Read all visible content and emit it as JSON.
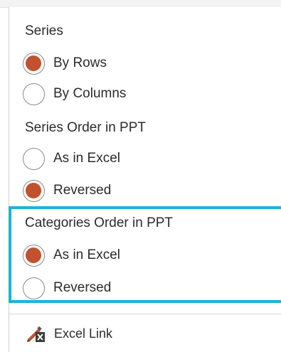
{
  "menu": {
    "series_heading": "Series",
    "series_options": [
      {
        "label": "By Rows",
        "selected": true
      },
      {
        "label": "By Columns",
        "selected": false
      }
    ],
    "series_order_heading": "Series Order in PPT",
    "series_order_options": [
      {
        "label": "As in Excel",
        "selected": false
      },
      {
        "label": "Reversed",
        "selected": true
      }
    ],
    "categories_order_heading": "Categories Order in PPT",
    "categories_order_options": [
      {
        "label": "As in Excel",
        "selected": true
      },
      {
        "label": "Reversed",
        "selected": false
      }
    ],
    "excel_link_label": "Excel Link",
    "excel_link_icon": "edit-excel-link-icon"
  },
  "colors": {
    "radio_selected": "#c0522f",
    "highlight_border": "#1bb3d9"
  }
}
